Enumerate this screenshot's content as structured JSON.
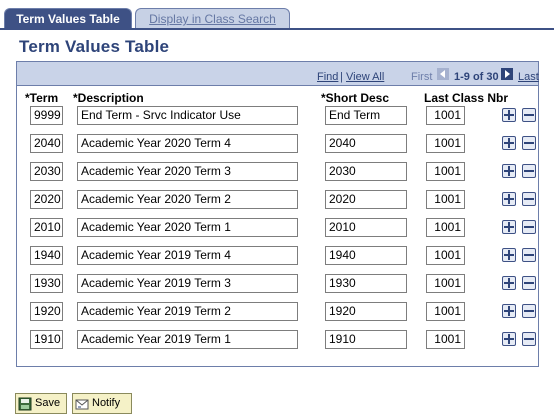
{
  "tabs": [
    {
      "label": "Term Values Table",
      "active": true
    },
    {
      "label": "Display in Class Search",
      "active": false
    }
  ],
  "page_title": "Term Values Table",
  "grid": {
    "nav": {
      "find": "Find",
      "separator": "|",
      "view_all": "View All",
      "first": "First",
      "range": "1-9 of 30",
      "last": "Last",
      "prev_icon": "prev-arrow-icon",
      "next_icon": "next-arrow-icon"
    },
    "headers": {
      "term": "*Term",
      "description": "*Description",
      "short_desc": "*Short Desc",
      "last_class_nbr": "Last Class Nbr"
    },
    "rows": [
      {
        "term": "9999",
        "description": "End Term - Srvc Indicator Use",
        "short_desc": "End Term",
        "last_class_nbr": "1001"
      },
      {
        "term": "2040",
        "description": "Academic Year 2020 Term 4",
        "short_desc": "2040",
        "last_class_nbr": "1001"
      },
      {
        "term": "2030",
        "description": "Academic Year 2020 Term 3",
        "short_desc": "2030",
        "last_class_nbr": "1001"
      },
      {
        "term": "2020",
        "description": "Academic Year 2020 Term 2",
        "short_desc": "2020",
        "last_class_nbr": "1001"
      },
      {
        "term": "2010",
        "description": "Academic Year 2020 Term 1",
        "short_desc": "2010",
        "last_class_nbr": "1001"
      },
      {
        "term": "1940",
        "description": "Academic Year 2019 Term 4",
        "short_desc": "1940",
        "last_class_nbr": "1001"
      },
      {
        "term": "1930",
        "description": "Academic Year 2019 Term 3",
        "short_desc": "1930",
        "last_class_nbr": "1001"
      },
      {
        "term": "1920",
        "description": "Academic Year 2019 Term 2",
        "short_desc": "1920",
        "last_class_nbr": "1001"
      },
      {
        "term": "1910",
        "description": "Academic Year 2019 Term 1",
        "short_desc": "1910",
        "last_class_nbr": "1001"
      }
    ],
    "row_icons": {
      "add": "plus-icon",
      "delete": "minus-icon"
    }
  },
  "toolbar": {
    "save_label": "Save",
    "notify_label": "Notify",
    "save_icon": "save-disk-icon",
    "notify_icon": "notify-icon"
  },
  "colors": {
    "tab_active_bg": "#3e5185",
    "tab_inactive_bg": "#c7d1e5",
    "title": "#2e4479",
    "grid_header_bg": "#c9d3e8",
    "button_bg": "#f5f1c7"
  }
}
